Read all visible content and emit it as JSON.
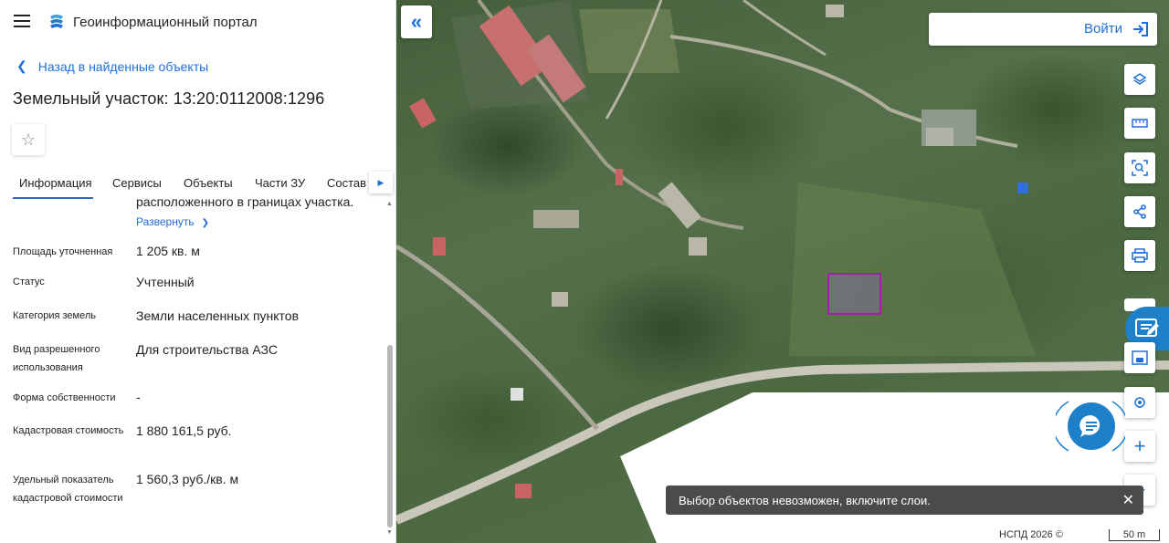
{
  "app": {
    "title": "Геоинформационный портал"
  },
  "nav": {
    "back_label": "Назад в найденные объекты"
  },
  "object": {
    "title": "Земельный участок: 13:20:0112008:1296"
  },
  "tabs": [
    {
      "label": "Информация",
      "active": true
    },
    {
      "label": "Сервисы",
      "active": false
    },
    {
      "label": "Объекты",
      "active": false
    },
    {
      "label": "Части ЗУ",
      "active": false
    },
    {
      "label": "Состав",
      "active": false
    }
  ],
  "info": {
    "description_tail": "расположенного в границах участка.",
    "expand_label": "Развернуть",
    "rows": [
      {
        "label": "Площадь уточненная",
        "value": "1 205 кв. м"
      },
      {
        "label": "Статус",
        "value": "Учтенный"
      },
      {
        "label": "Категория земель",
        "value": "Земли населенных пунктов"
      },
      {
        "label": "Вид разрешенного использования",
        "value": "Для строительства АЗС"
      },
      {
        "label": "Форма собственности",
        "value": "-"
      },
      {
        "label": "Кадастровая стоимость",
        "value": "1 880 161,5 руб."
      },
      {
        "label": "Удельный показатель кадастровой стоимости",
        "value": "1 560,3 руб./кв. м"
      }
    ]
  },
  "map": {
    "login_label": "Войти",
    "toast_message": "Выбор объектов невозможен, включите слои.",
    "attribution": "НСПД 2026 ©",
    "scale_label": "50 m",
    "tools": [
      "layers-icon",
      "ruler-icon",
      "search-area-icon",
      "share-icon",
      "print-icon",
      "minimap-icon",
      "locate-icon",
      "zoom-in-icon",
      "zoom-out-icon"
    ]
  },
  "colors": {
    "accent": "#1e6fd9",
    "chat": "#1e80c8",
    "parcel": "#a020a8",
    "toast": "#4b4b4b"
  }
}
